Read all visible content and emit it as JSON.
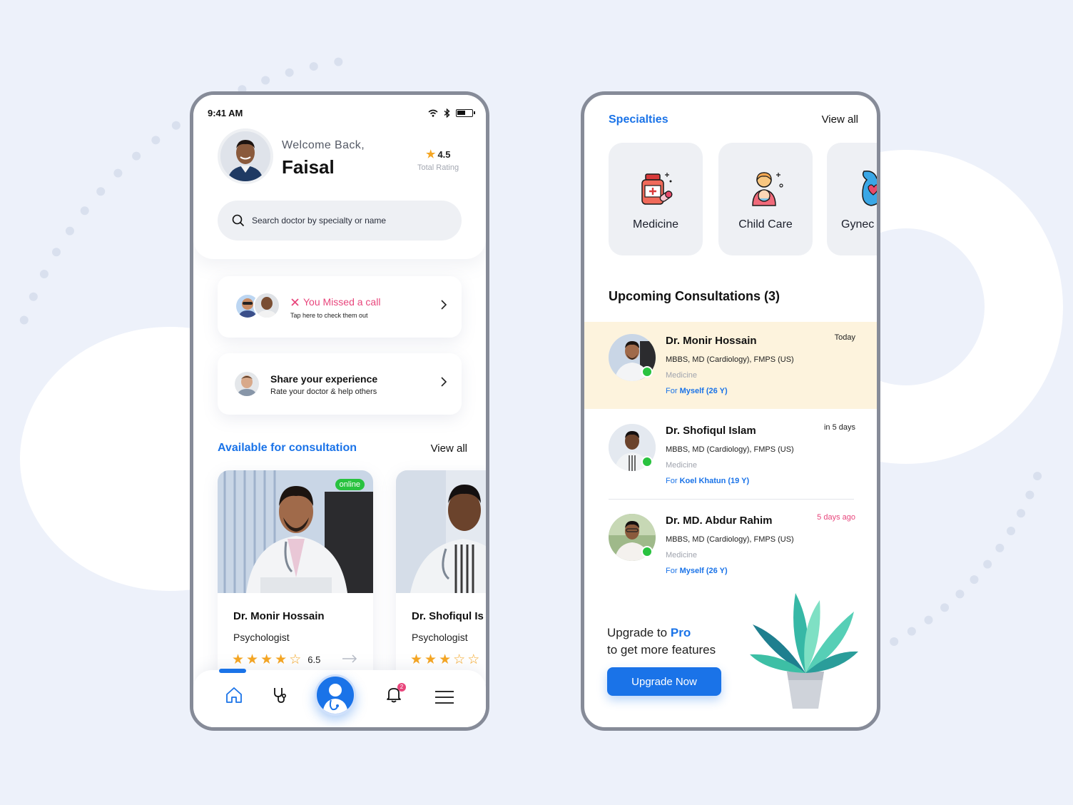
{
  "colors": {
    "accent": "#1a73e8",
    "alert": "#e8467c",
    "online": "#29c23f",
    "star": "#f5a623",
    "highlight": "#fdf3dd"
  },
  "left": {
    "status": {
      "time": "9:41 AM",
      "icons": [
        "wifi-icon",
        "bluetooth-icon",
        "battery-icon"
      ]
    },
    "header": {
      "welcome": "Welcome Back,",
      "name": "Faisal",
      "rating": "4.5",
      "rating_label": "Total Rating"
    },
    "search": {
      "placeholder": "Search doctor by specialty or name"
    },
    "missed": {
      "title": "You Missed a call",
      "subtitle": "Tap here to check them out"
    },
    "share": {
      "title": "Share your experience",
      "subtitle": "Rate your doctor & help others"
    },
    "available": {
      "title": "Available for consultation",
      "view_all": "View all",
      "doctors": [
        {
          "name": "Dr. Monir Hossain",
          "specialty": "Psychologist",
          "rating": 6.5,
          "rating_label": "6.5",
          "status": "online"
        },
        {
          "name": "Dr. Shofiqul Is",
          "specialty": "Psychologist"
        }
      ]
    },
    "nav": {
      "items": [
        "home-icon",
        "stethoscope-icon",
        "doctor-icon",
        "bell-icon",
        "menu-icon"
      ],
      "bell_badge": "2"
    }
  },
  "right": {
    "specialties": {
      "title": "Specialties",
      "view_all": "View all",
      "items": [
        {
          "label": "Medicine",
          "icon": "medicine-icon"
        },
        {
          "label": "Child Care",
          "icon": "child-care-icon"
        },
        {
          "label": "Gynec",
          "icon": "gynecology-icon"
        }
      ]
    },
    "upcoming": {
      "title": "Upcoming Consultations (3)",
      "items": [
        {
          "name": "Dr. Monir Hossain",
          "degree": "MBBS, MD (Cardiology), FMPS (US)",
          "specialty": "Medicine",
          "for_prefix": "For",
          "patient": "Myself (26 Y)",
          "when": "Today"
        },
        {
          "name": "Dr. Shofiqul Islam",
          "degree": "MBBS, MD (Cardiology), FMPS (US)",
          "specialty": "Medicine",
          "for_prefix": "For",
          "patient": "Koel Khatun (19 Y)",
          "when": "in 5 days"
        },
        {
          "name": "Dr. MD. Abdur Rahim",
          "degree": "MBBS, MD (Cardiology), FMPS (US)",
          "specialty": "Medicine",
          "for_prefix": "For",
          "patient": "Myself (26 Y)",
          "when": "5 days ago"
        }
      ]
    },
    "upgrade": {
      "line1_prefix": "Upgrade to",
      "line1_brand": "Pro",
      "line2": "to get more features",
      "button": "Upgrade Now"
    }
  }
}
